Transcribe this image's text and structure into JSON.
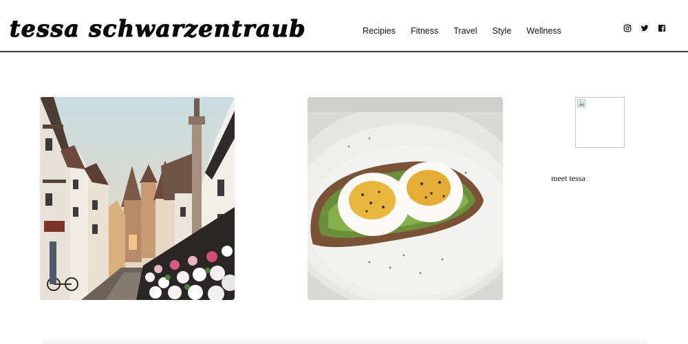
{
  "header": {
    "logo": "tessa schwarzentraub",
    "nav": [
      "Recipies",
      "Fitness",
      "Travel",
      "Style",
      "Wellness"
    ],
    "social": [
      "instagram-icon",
      "twitter-icon",
      "facebook-icon"
    ]
  },
  "posts": [
    {
      "image": "old-town-street-photo"
    },
    {
      "image": "avocado-egg-toast-photo"
    }
  ],
  "sidebar": {
    "profile_image": "broken-image-icon",
    "meet_label": "meet tessa"
  }
}
